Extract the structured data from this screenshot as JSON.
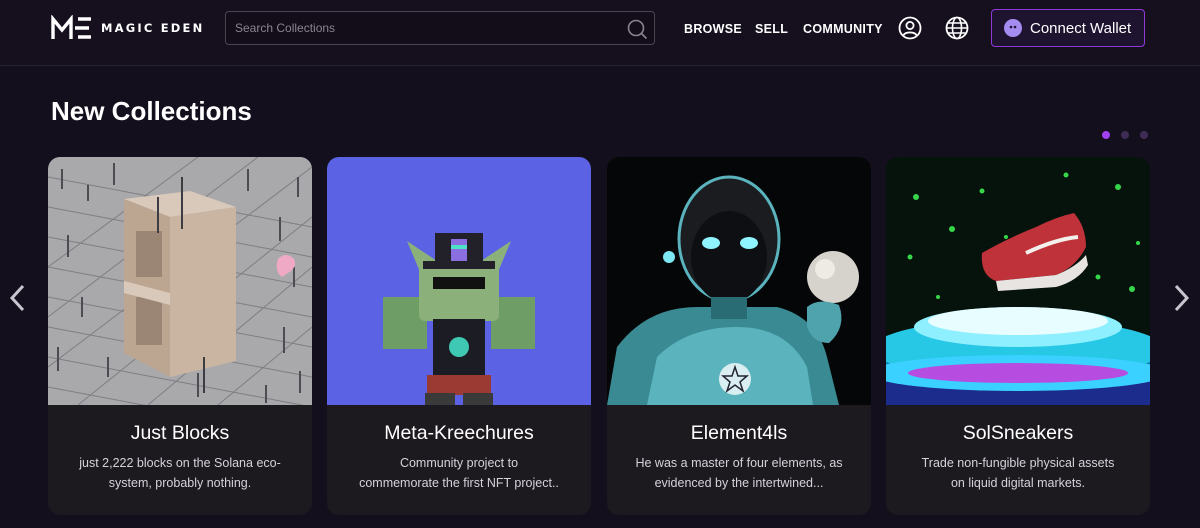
{
  "brand": {
    "name": "MAGIC EDEN"
  },
  "search": {
    "placeholder": "Search Collections"
  },
  "nav": {
    "browse": "BROWSE",
    "sell": "SELL",
    "community": "COMMUNITY"
  },
  "header_icons": [
    "user-circle-icon",
    "globe-icon"
  ],
  "connect_wallet": {
    "label": "Connect Wallet"
  },
  "section": {
    "title": "New Collections"
  },
  "carousel": {
    "pages": 3,
    "active_page": 1
  },
  "collections": [
    {
      "title": "Just Blocks",
      "desc_line1": "just 2,222 blocks on the Solana eco-",
      "desc_line2": "system, probably nothing."
    },
    {
      "title": "Meta-Kreechures",
      "desc_line1": "Community project to",
      "desc_line2": "commemorate the first NFT project.."
    },
    {
      "title": "Element4ls",
      "desc_line1": "He was a master of four elements, as",
      "desc_line2": "evidenced by the intertwined..."
    },
    {
      "title": "SolSneakers",
      "desc_line1": "Trade non-fungible physical assets",
      "desc_line2": "on liquid digital markets."
    }
  ],
  "colors": {
    "background": "#140f1c",
    "accent": "#a040f0",
    "card": "#1c1a1f"
  }
}
